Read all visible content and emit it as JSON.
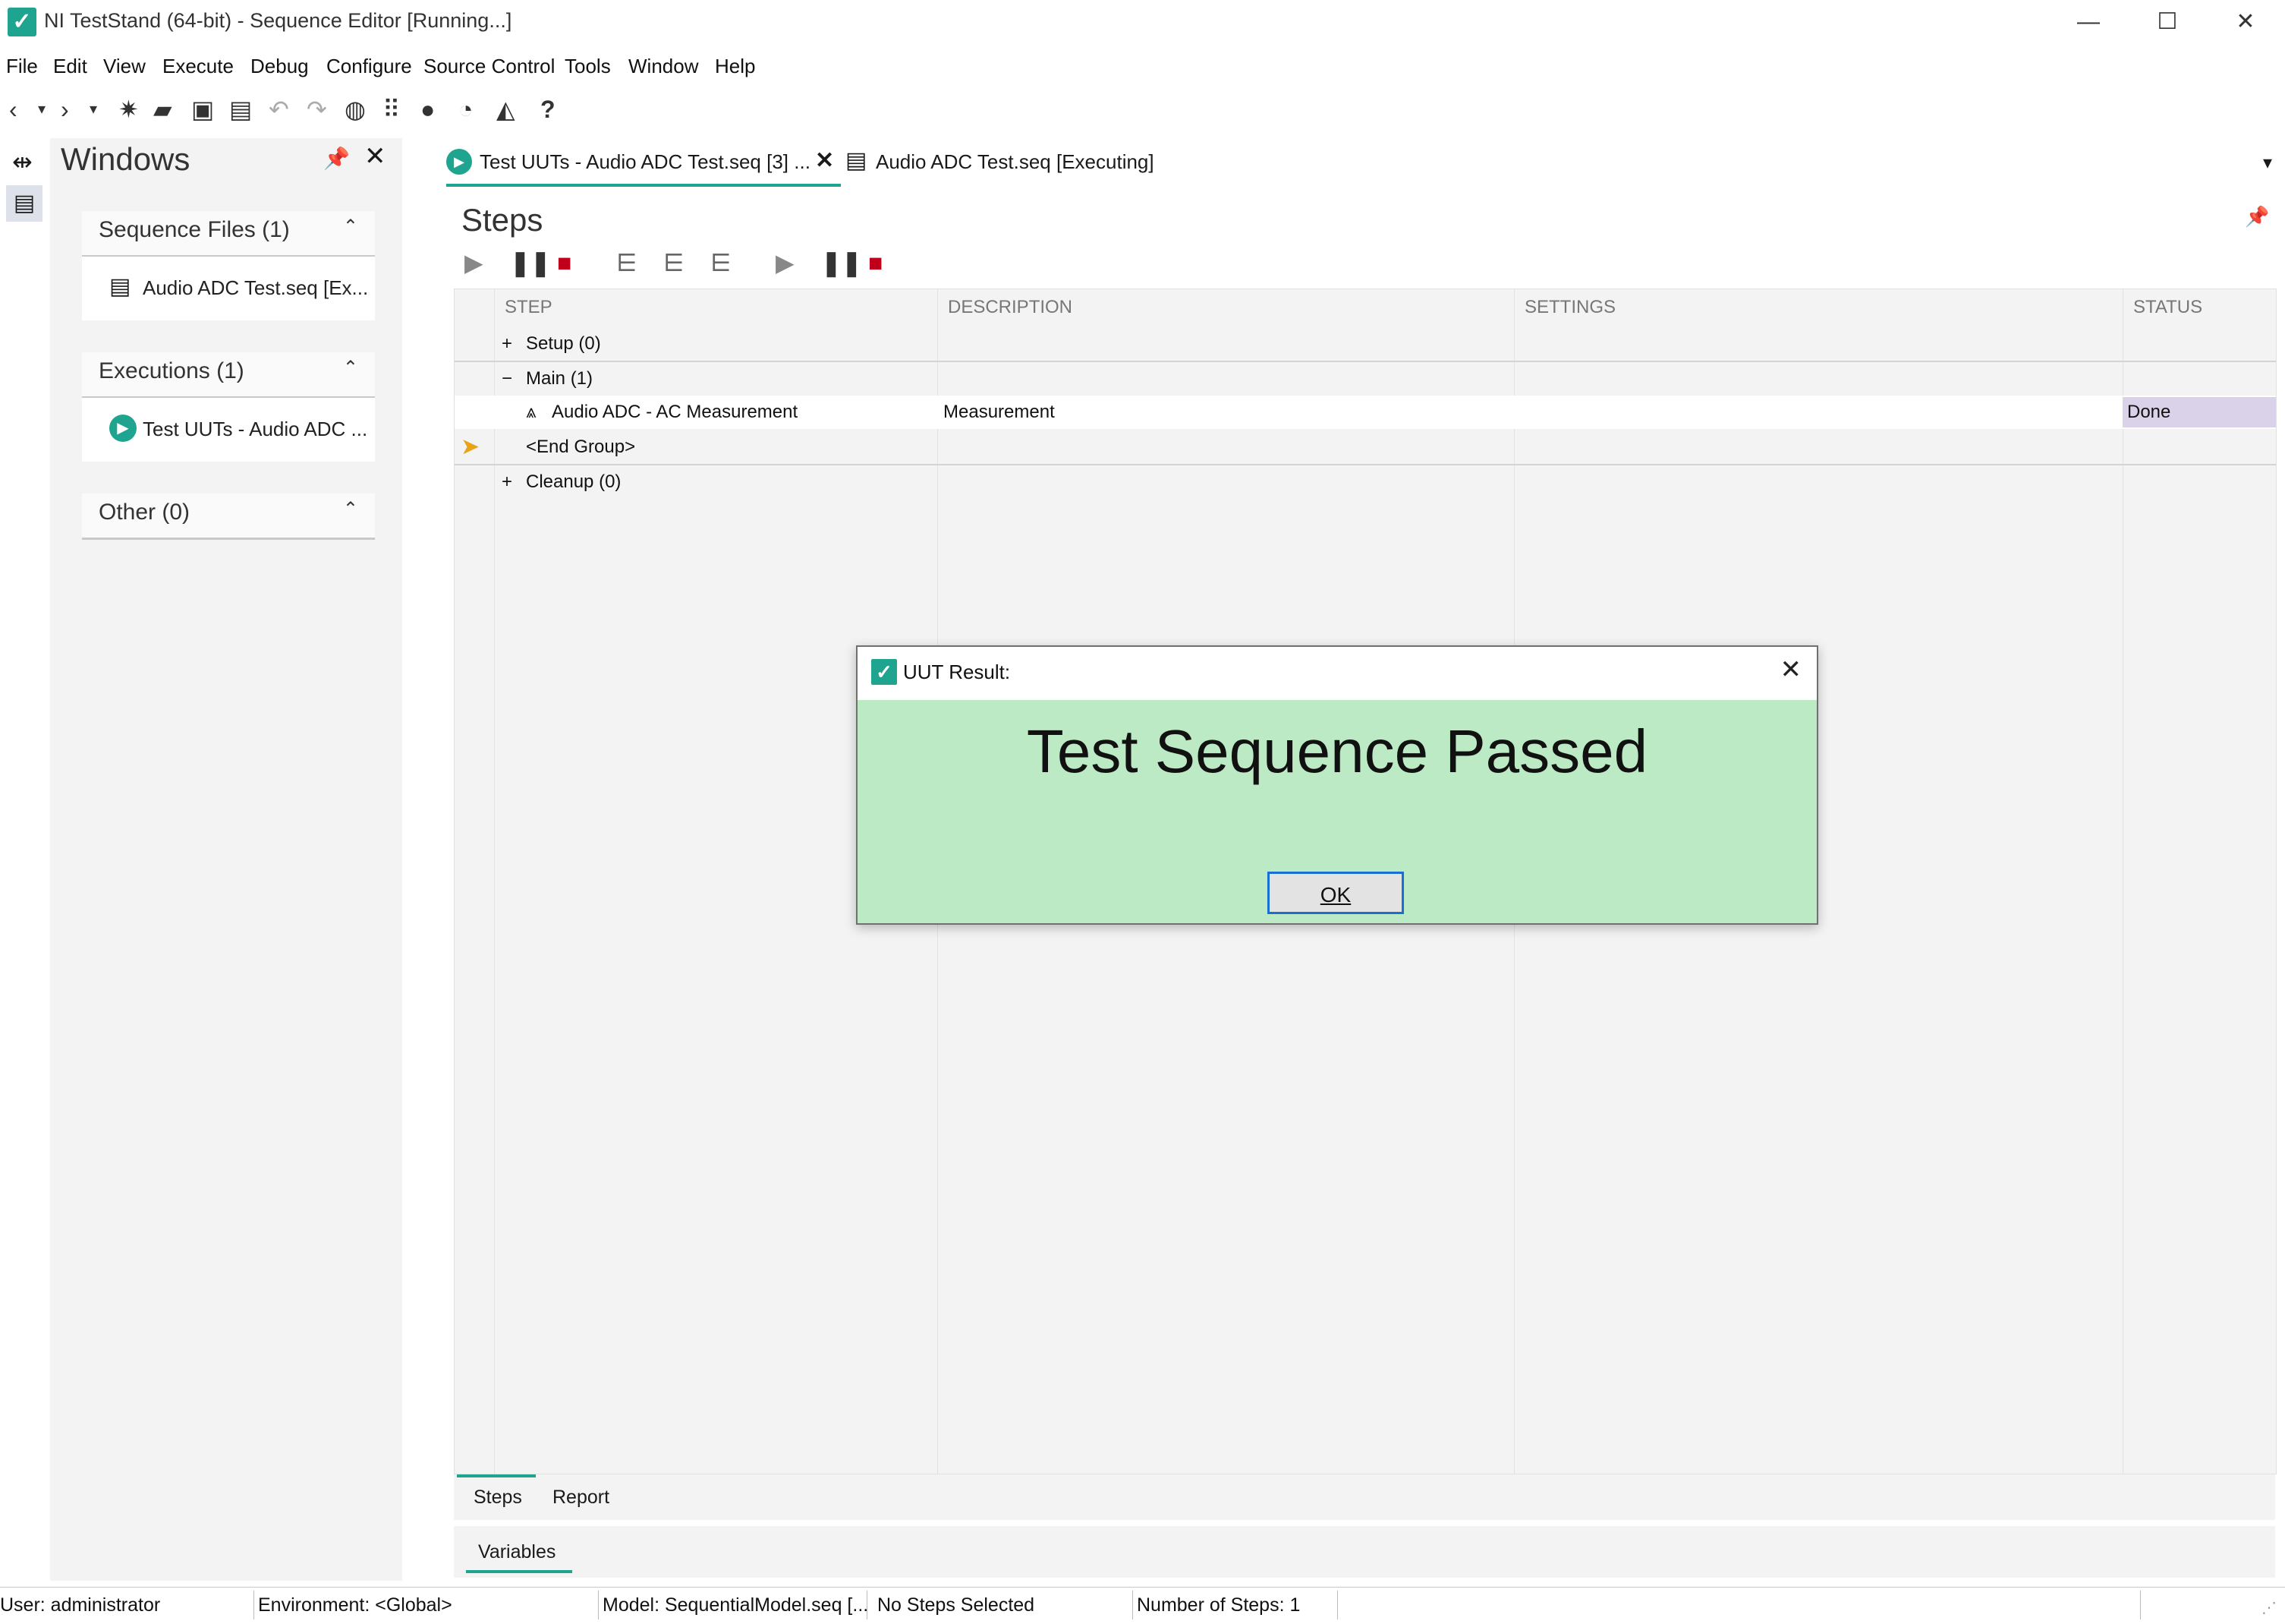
{
  "window": {
    "title": "NI TestStand (64-bit) - Sequence Editor [Running...]",
    "minimize": "—",
    "maximize": "☐",
    "close": "✕"
  },
  "menu": [
    "File",
    "Edit",
    "View",
    "Execute",
    "Debug",
    "Configure",
    "Source Control",
    "Tools",
    "Window",
    "Help"
  ],
  "windows_pane": {
    "title": "Windows",
    "sections": [
      {
        "header": "Sequence Files (1)",
        "item": "Audio ADC Test.seq [Ex..."
      },
      {
        "header": "Executions (1)",
        "item": "Test UUTs - Audio ADC ..."
      },
      {
        "header": "Other (0)"
      }
    ]
  },
  "doc_tabs": [
    {
      "label": "Test UUTs - Audio ADC Test.seq [3] ..."
    },
    {
      "label": "Audio ADC Test.seq [Executing]"
    }
  ],
  "steps": {
    "title": "Steps",
    "columns": [
      "STEP",
      "DESCRIPTION",
      "SETTINGS",
      "STATUS"
    ],
    "rows": [
      {
        "expander": "+",
        "step": "Setup (0)",
        "description": "",
        "status": ""
      },
      {
        "expander": "−",
        "step": "Main (1)",
        "description": "",
        "status": ""
      },
      {
        "expander": "",
        "step": "Audio ADC - AC Measurement",
        "description": "Measurement",
        "status": "Done"
      },
      {
        "expander": "",
        "step": "<End Group>",
        "description": "",
        "status": ""
      },
      {
        "expander": "+",
        "step": "Cleanup (0)",
        "description": "",
        "status": ""
      }
    ]
  },
  "bottom_tabs": [
    "Steps",
    "Report"
  ],
  "var_tab": "Variables",
  "status_bar": [
    "User: administrator",
    "Environment: <Global>",
    "Model: SequentialModel.seq [...",
    "No Steps Selected",
    "Number of Steps: 1"
  ],
  "dialog": {
    "title": "UUT Result:",
    "message": "Test Sequence Passed",
    "ok_label": "OK",
    "body_color": "#bbeac4"
  },
  "colors": {
    "accent": "#1fa58f",
    "status_done_bg": "#d9d2e9",
    "stop_red": "#c0001a",
    "arrow_yellow": "#e8a317"
  }
}
